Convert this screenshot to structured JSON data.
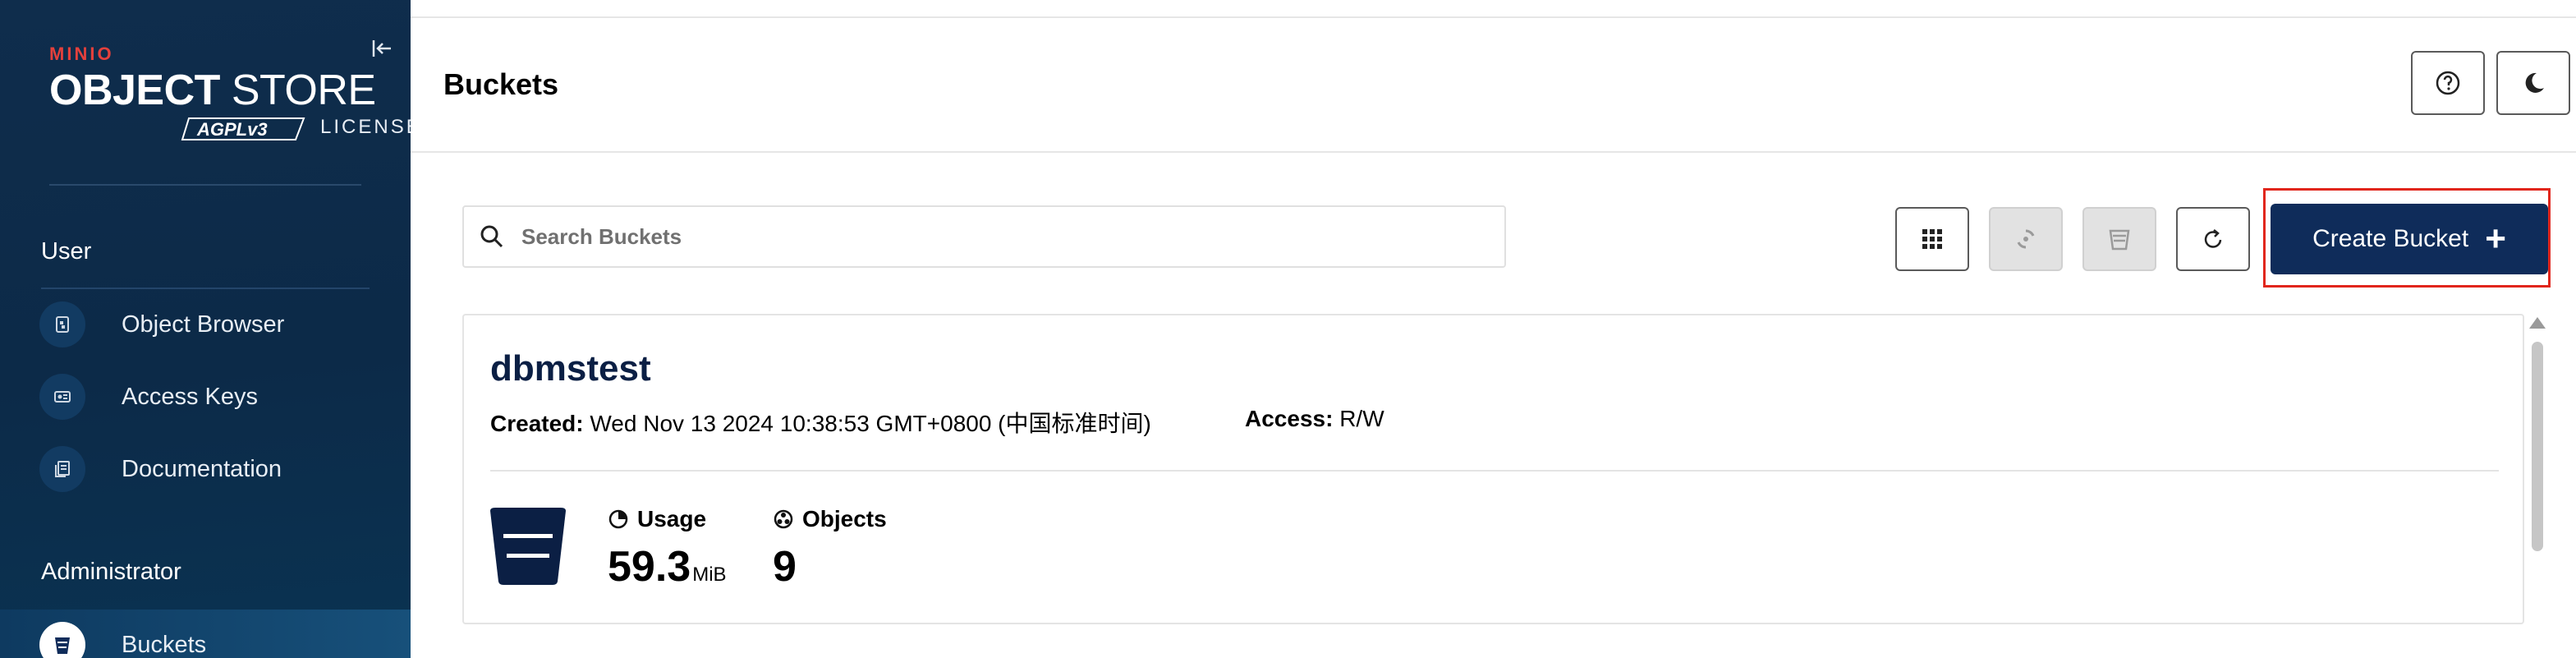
{
  "sidebar": {
    "logo": {
      "minio": "MINIO",
      "brand_bold": "OBJECT",
      "brand_light": "STORE",
      "agpl": "AGPLv3",
      "license": "LICENSE"
    },
    "sections": [
      {
        "title": "User",
        "items": [
          {
            "label": "Object Browser",
            "icon": "object-browser-icon"
          },
          {
            "label": "Access Keys",
            "icon": "access-keys-icon"
          },
          {
            "label": "Documentation",
            "icon": "documentation-icon"
          }
        ]
      },
      {
        "title": "Administrator",
        "items": [
          {
            "label": "Buckets",
            "icon": "bucket-icon",
            "active": true
          }
        ]
      }
    ]
  },
  "header": {
    "title": "Buckets"
  },
  "toolbar": {
    "search_placeholder": "Search Buckets",
    "create_label": "Create Bucket",
    "create_icon": "+"
  },
  "buckets": [
    {
      "name": "dbmstest",
      "created_label": "Created:",
      "created_value": "Wed Nov 13 2024 10:38:53 GMT+0800 (中国标准时间)",
      "access_label": "Access:",
      "access_value": "R/W",
      "usage_label": "Usage",
      "usage_value": "59.3",
      "usage_unit": "MiB",
      "objects_label": "Objects",
      "objects_value": "9"
    }
  ],
  "colors": {
    "sidebar_bg": "#0c2a48",
    "primary": "#0f2c5a",
    "highlight": "#e1261c",
    "minio_red": "#e4403c"
  }
}
